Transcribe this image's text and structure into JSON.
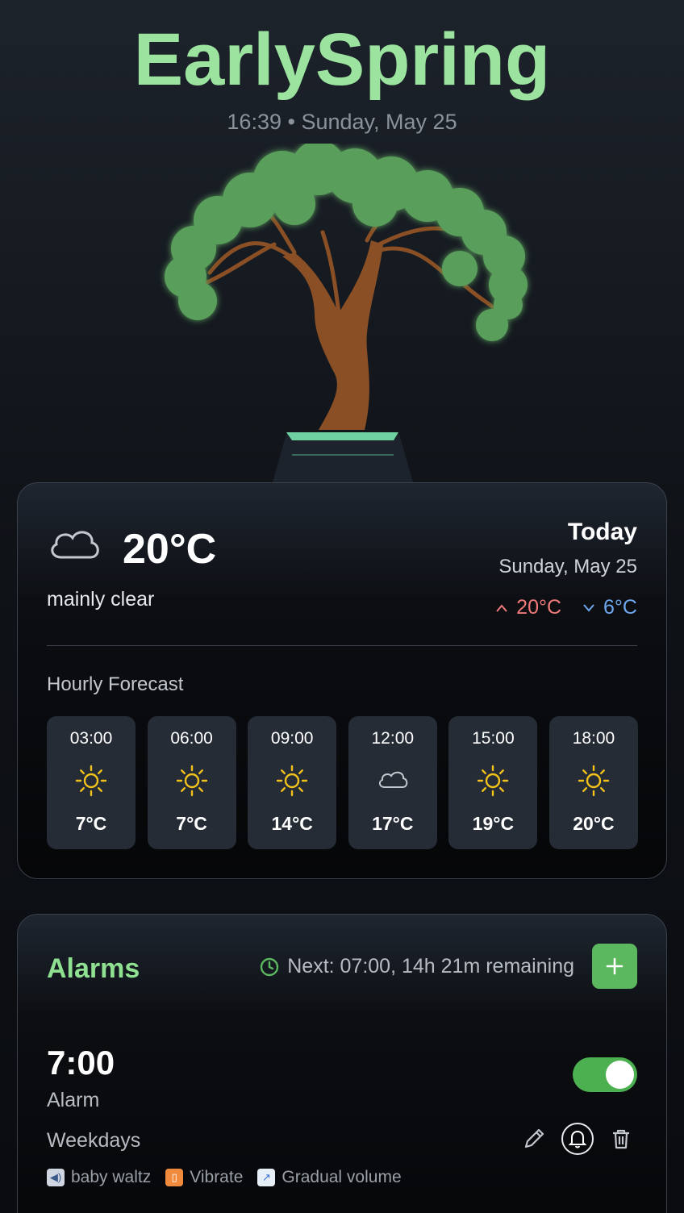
{
  "app": {
    "title": "EarlySpring",
    "time": "16:39",
    "date": "Sunday, May 25",
    "separator": "•"
  },
  "weather": {
    "current_icon": "cloud-icon",
    "current_temp": "20°C",
    "condition": "mainly clear",
    "today_label": "Today",
    "today_date": "Sunday, May 25",
    "high": "20°C",
    "low": "6°C",
    "hourly_title": "Hourly Forecast",
    "hourly": [
      {
        "time": "03:00",
        "icon": "sun-icon",
        "temp": "7°C"
      },
      {
        "time": "06:00",
        "icon": "sun-icon",
        "temp": "7°C"
      },
      {
        "time": "09:00",
        "icon": "sun-icon",
        "temp": "14°C"
      },
      {
        "time": "12:00",
        "icon": "cloud-icon",
        "temp": "17°C"
      },
      {
        "time": "15:00",
        "icon": "sun-icon",
        "temp": "19°C"
      },
      {
        "time": "18:00",
        "icon": "sun-icon",
        "temp": "20°C"
      }
    ]
  },
  "alarms": {
    "title": "Alarms",
    "next": "Next: 07:00, 14h 21m remaining",
    "add_label": "+",
    "items": [
      {
        "time": "7:00",
        "label": "Alarm",
        "days": "Weekdays",
        "enabled": true,
        "sound": "baby waltz",
        "vibrate": "Vibrate",
        "gradual": "Gradual volume"
      }
    ]
  },
  "colors": {
    "accent": "#9be39e",
    "toggle_on": "#4caf50",
    "high": "#f07a7a",
    "low": "#6ea8f0",
    "sun": "#f2c21b"
  }
}
